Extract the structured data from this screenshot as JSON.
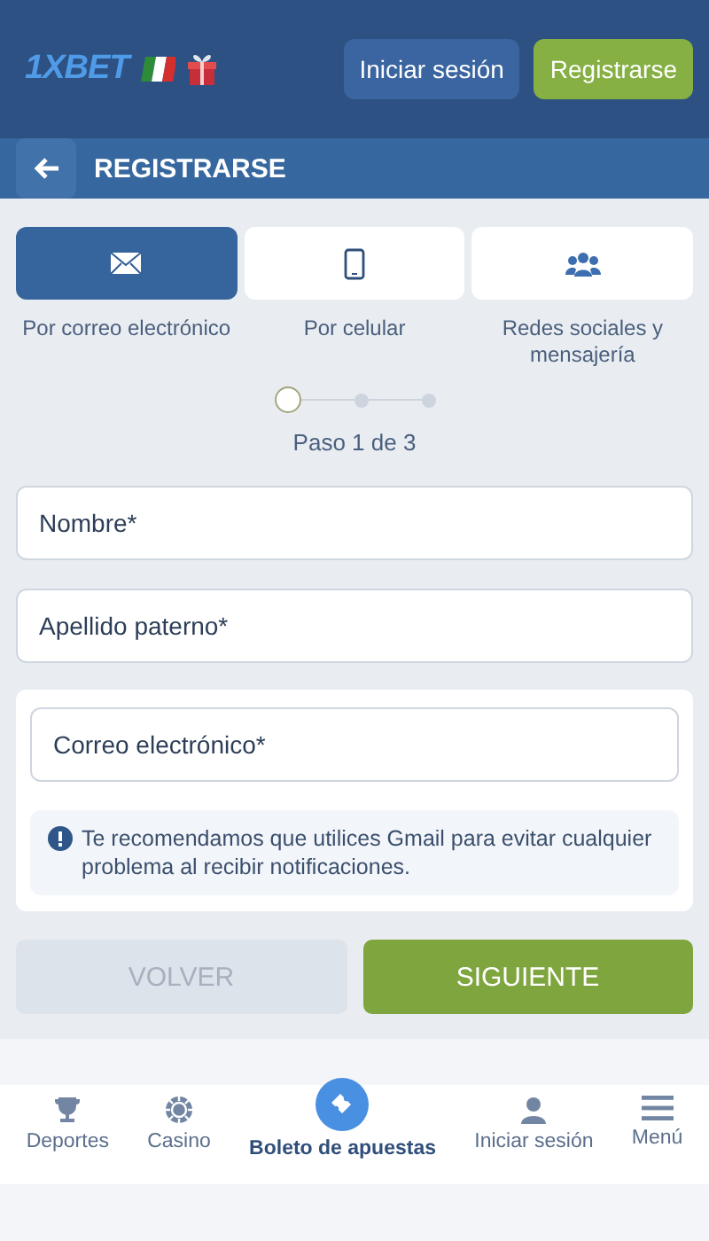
{
  "header": {
    "logo": "1XBET",
    "buttons": [
      {
        "label": "Iniciar sesión",
        "kind": "secondary"
      },
      {
        "label": "Registrarse",
        "kind": "primary"
      }
    ]
  },
  "title_bar": {
    "title": "REGISTRARSE"
  },
  "methods": [
    {
      "label": "Por correo electrónico",
      "selected": true
    },
    {
      "label": "Por celular",
      "selected": false
    },
    {
      "label": "Redes sociales y mensajería",
      "selected": false
    }
  ],
  "stepper": {
    "steps": [
      {
        "selected": true
      },
      {
        "selected": false
      },
      {
        "selected": false
      }
    ],
    "label": "Paso 1 de 3"
  },
  "fields": [
    {
      "placeholder": "Nombre*"
    },
    {
      "placeholder": "Apellido paterno*"
    }
  ],
  "email_card": {
    "field": {
      "placeholder": "Correo electrónico*"
    },
    "notice": "Te recomendamos que utilices Gmail para evitar cualquier problema al recibir notificaciones."
  },
  "actions": [
    {
      "label": "VOLVER",
      "disabled": true
    },
    {
      "label": "SIGUIENTE",
      "disabled": false
    }
  ],
  "bottom_nav": [
    {
      "label": "Deportes",
      "selected": false
    },
    {
      "label": "Casino",
      "selected": false
    },
    {
      "label": "Boleto de apuestas",
      "selected": true
    },
    {
      "label": "Iniciar sesión",
      "selected": false
    },
    {
      "label": "Menú",
      "selected": false
    }
  ]
}
